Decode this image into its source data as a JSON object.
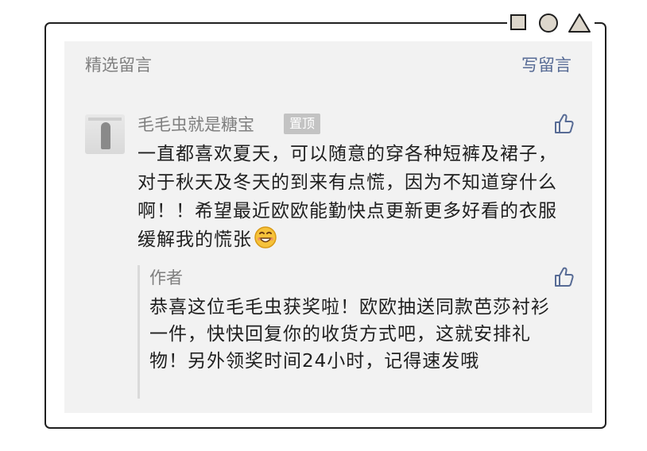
{
  "header": {
    "title": "精选留言",
    "write_label": "写留言"
  },
  "comment": {
    "author": "毛毛虫就是糖宝",
    "pin_badge": "置顶",
    "text": "一直都喜欢夏天，可以随意的穿各种短裤及裙子，对于秋天及冬天的到来有点慌，因为不知道穿什么啊！！希望最近欧欧能勤快点更新更多好看的衣服缓解我的慌张",
    "emoji": "grinning-face-emoji",
    "like_icon": "thumbs-up-icon"
  },
  "reply": {
    "author": "作者",
    "text": "恭喜这位毛毛虫获奖啦！欧欧抽送同款芭莎衬衫一件，快快回复你的收货方式吧，这就安排礼物！另外领奖时间24小时，记得速发哦",
    "like_icon": "thumbs-up-icon"
  },
  "colors": {
    "link": "#576b95",
    "meta": "#7f7f7f",
    "card_bg": "#f2f2f2",
    "badge_bg": "#c3c3c3"
  }
}
